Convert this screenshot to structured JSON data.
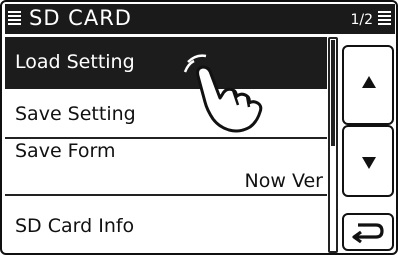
{
  "header": {
    "title": "SD CARD",
    "page_indicator": "1/2"
  },
  "menu": {
    "items": [
      {
        "label": "Load Setting",
        "value": "",
        "selected": true
      },
      {
        "label": "Save Setting",
        "value": ""
      },
      {
        "label": "Save Form",
        "value": "Now Ver"
      },
      {
        "label": "SD Card Info",
        "value": ""
      }
    ]
  },
  "icons": {
    "title_menu": "list-icon",
    "page_menu": "list-icon",
    "up": "triangle-up-icon",
    "down": "triangle-down-icon",
    "back": "return-arrow-icon",
    "pointer": "pointing-hand-icon"
  },
  "colors": {
    "titlebar": "#1a1a1a",
    "selected_row": "#1c1c1c",
    "background": "#ffffff"
  }
}
